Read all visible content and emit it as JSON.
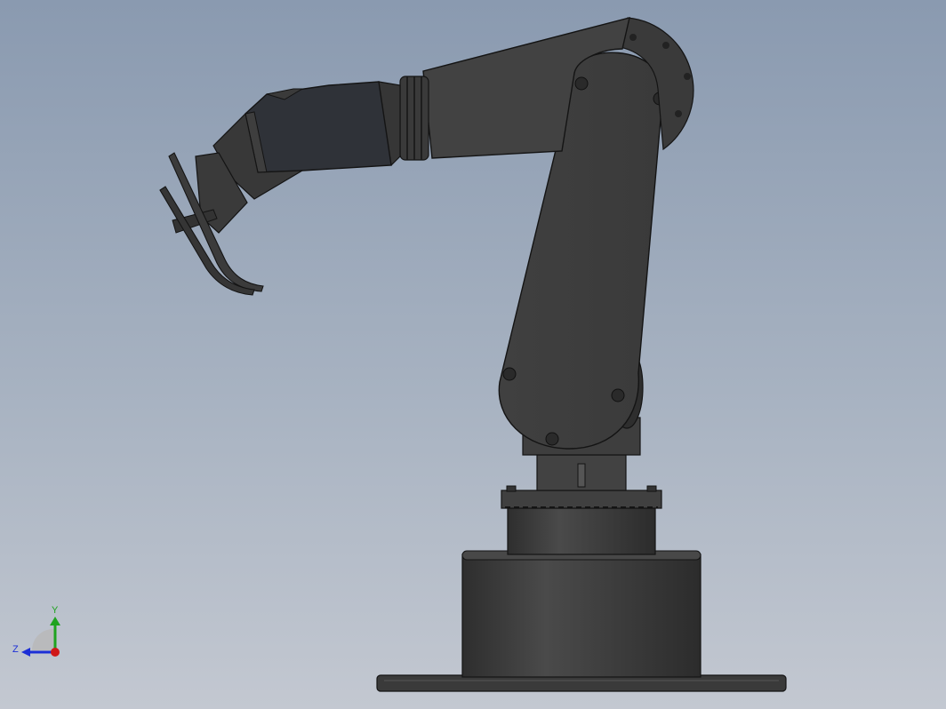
{
  "viewport": {
    "background_top": "#8a9ab0",
    "background_bottom": "#c3c8d1"
  },
  "model": {
    "body_color": "#3d3d3d",
    "edge_color": "#141414",
    "highlight_color": "#5a5a5a"
  },
  "triad": {
    "y_label": "Y",
    "z_label": "Z",
    "y_color": "#1fa31f",
    "z_color": "#1c2fd6",
    "origin_color": "#d01818"
  }
}
